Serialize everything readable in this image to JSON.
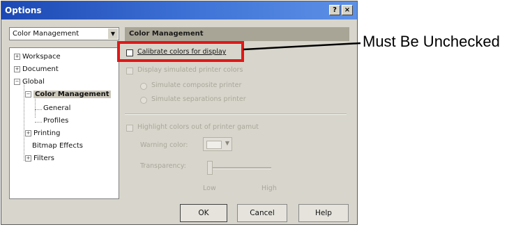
{
  "window": {
    "title": "Options",
    "help_btn": "?",
    "close_btn": "×"
  },
  "category_select": {
    "value": "Color Management"
  },
  "tree": {
    "items": [
      {
        "label": "Workspace",
        "expander": "+"
      },
      {
        "label": "Document",
        "expander": "+"
      },
      {
        "label": "Global",
        "expander": "−"
      },
      {
        "label": "Color Management",
        "expander": "−"
      },
      {
        "label": "General"
      },
      {
        "label": "Profiles"
      },
      {
        "label": "Printing",
        "expander": "+"
      },
      {
        "label": "Bitmap Effects"
      },
      {
        "label": "Filters",
        "expander": "+"
      }
    ]
  },
  "panel": {
    "header": "Color Management",
    "calibrate": {
      "label": "Calibrate colors for display",
      "checked": false
    },
    "display_simulated": "Display simulated printer colors",
    "simulate_composite": "Simulate composite printer",
    "simulate_separations": "Simulate separations printer",
    "highlight_gamut": "Highlight colors out of printer gamut",
    "warning_color": "Warning color:",
    "transparency": "Transparency:",
    "slider_low": "Low",
    "slider_high": "High"
  },
  "buttons": {
    "ok": "OK",
    "cancel": "Cancel",
    "help": "Help"
  },
  "annotation": {
    "callout": "Must Be Unchecked",
    "highlight_color": "#e01818"
  },
  "colors": {
    "titlebar": "#1c48b4",
    "dialog_bg": "#d8d6cc"
  }
}
